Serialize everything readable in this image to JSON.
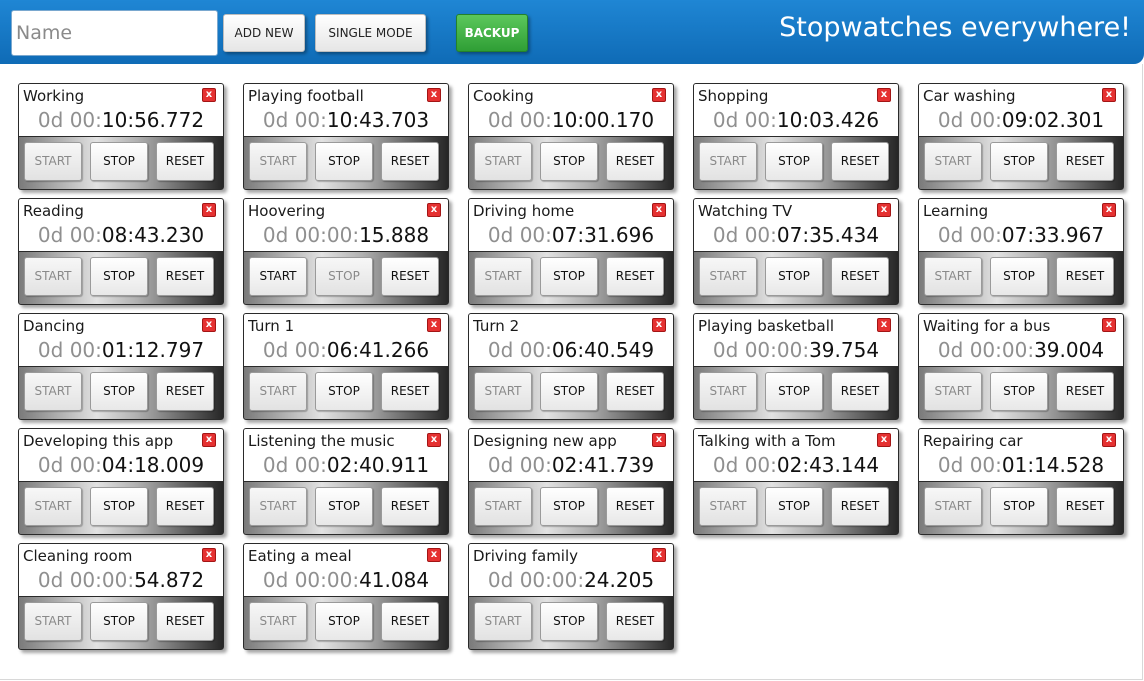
{
  "header": {
    "name_placeholder": "Name",
    "name_value": "",
    "add_new_label": "ADD NEW",
    "single_mode_label": "SINGLE MODE",
    "backup_label": "BACKUP",
    "title": "Stopwatches everywhere!"
  },
  "buttons": {
    "start": "START",
    "stop": "STOP",
    "reset": "RESET",
    "close_glyph": "x"
  },
  "colors": {
    "header_blue": "#1478c8",
    "backup_green": "#3db142",
    "close_red": "#e53131"
  },
  "stopwatches": [
    {
      "name": "Working",
      "time_dim": "0d 00:",
      "time_lit": "10:56.772",
      "running": true
    },
    {
      "name": "Playing football",
      "time_dim": "0d 00:",
      "time_lit": "10:43.703",
      "running": true
    },
    {
      "name": "Cooking",
      "time_dim": "0d 00:",
      "time_lit": "10:00.170",
      "running": true
    },
    {
      "name": "Shopping",
      "time_dim": "0d 00:",
      "time_lit": "10:03.426",
      "running": true
    },
    {
      "name": "Car washing",
      "time_dim": "0d 00:",
      "time_lit": "09:02.301",
      "running": true
    },
    {
      "name": "Reading",
      "time_dim": "0d 00:",
      "time_lit": "08:43.230",
      "running": true
    },
    {
      "name": "Hoovering",
      "time_dim": "0d 00:00:",
      "time_lit": "15.888",
      "running": false
    },
    {
      "name": "Driving home",
      "time_dim": "0d 00:",
      "time_lit": "07:31.696",
      "running": true
    },
    {
      "name": "Watching TV",
      "time_dim": "0d 00:",
      "time_lit": "07:35.434",
      "running": true
    },
    {
      "name": "Learning",
      "time_dim": "0d 00:",
      "time_lit": "07:33.967",
      "running": true
    },
    {
      "name": "Dancing",
      "time_dim": "0d 00:",
      "time_lit": "01:12.797",
      "running": true
    },
    {
      "name": "Turn 1",
      "time_dim": "0d 00:",
      "time_lit": "06:41.266",
      "running": true
    },
    {
      "name": "Turn 2",
      "time_dim": "0d 00:",
      "time_lit": "06:40.549",
      "running": true
    },
    {
      "name": "Playing basketball",
      "time_dim": "0d 00:00:",
      "time_lit": "39.754",
      "running": true
    },
    {
      "name": "Waiting for a bus",
      "time_dim": "0d 00:00:",
      "time_lit": "39.004",
      "running": true
    },
    {
      "name": "Developing this app",
      "time_dim": "0d 00:",
      "time_lit": "04:18.009",
      "running": true
    },
    {
      "name": "Listening the music",
      "time_dim": "0d 00:",
      "time_lit": "02:40.911",
      "running": true
    },
    {
      "name": "Designing new app",
      "time_dim": "0d 00:",
      "time_lit": "02:41.739",
      "running": true
    },
    {
      "name": "Talking with a Tom",
      "time_dim": "0d 00:",
      "time_lit": "02:43.144",
      "running": true
    },
    {
      "name": "Repairing car",
      "time_dim": "0d 00:",
      "time_lit": "01:14.528",
      "running": true
    },
    {
      "name": "Cleaning room",
      "time_dim": "0d 00:00:",
      "time_lit": "54.872",
      "running": true
    },
    {
      "name": "Eating a meal",
      "time_dim": "0d 00:00:",
      "time_lit": "41.084",
      "running": true
    },
    {
      "name": "Driving family",
      "time_dim": "0d 00:00:",
      "time_lit": "24.205",
      "running": true
    }
  ]
}
